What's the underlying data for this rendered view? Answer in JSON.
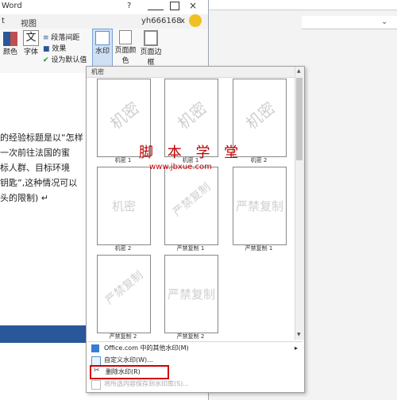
{
  "window": {
    "title_fragment": "Word",
    "help_icon": "?",
    "user": "yh666168",
    "user_close": "x"
  },
  "ribbon": {
    "tabs": [
      "t",
      "视图"
    ],
    "buttons": {
      "color": "颜色",
      "font": "字体",
      "para_spacing": "段落间距",
      "effects": "效果",
      "set_default": "设为默认值",
      "watermark": "水印",
      "page_color": "页面颜色",
      "page_border": "页面边框"
    }
  },
  "document": {
    "lines": [
      "的经验标题是以“怎样",
      "一次前往法国的蜜",
      "标人群、目标环境",
      "钥匙”,这种情况可以",
      "头的限制) ↵"
    ]
  },
  "dropdown": {
    "header": "机密",
    "thumbnails": [
      {
        "text": "机密",
        "caption": "机密 1",
        "style": "diagonal"
      },
      {
        "text": "机密",
        "caption": "机密 1",
        "style": "diagonal"
      },
      {
        "text": "机密",
        "caption": "机密 2",
        "style": "diagonal"
      },
      {
        "text": "机密",
        "caption": "机密 2",
        "style": "horizontal"
      },
      {
        "text": "严禁复制",
        "caption": "严禁复制 1",
        "style": "diagonal"
      },
      {
        "text": "严禁复制",
        "caption": "严禁复制 1",
        "style": "horizontal"
      },
      {
        "text": "严禁复制",
        "caption": "严禁复制 2",
        "style": "diagonal"
      },
      {
        "text": "严禁复制",
        "caption": "严禁复制 2",
        "style": "horizontal"
      }
    ],
    "menu": {
      "more": "Office.com 中的其他水印(M)",
      "custom": "自定义水印(W)...",
      "remove": "删除水印(R)",
      "save": "将所选内容保存到水印库(S)..."
    }
  },
  "overlay": {
    "text": "脚 本 学 堂",
    "url": "www.jbxue.com"
  },
  "colors": {
    "accent": "#2a579a",
    "highlight": "#d10000"
  }
}
